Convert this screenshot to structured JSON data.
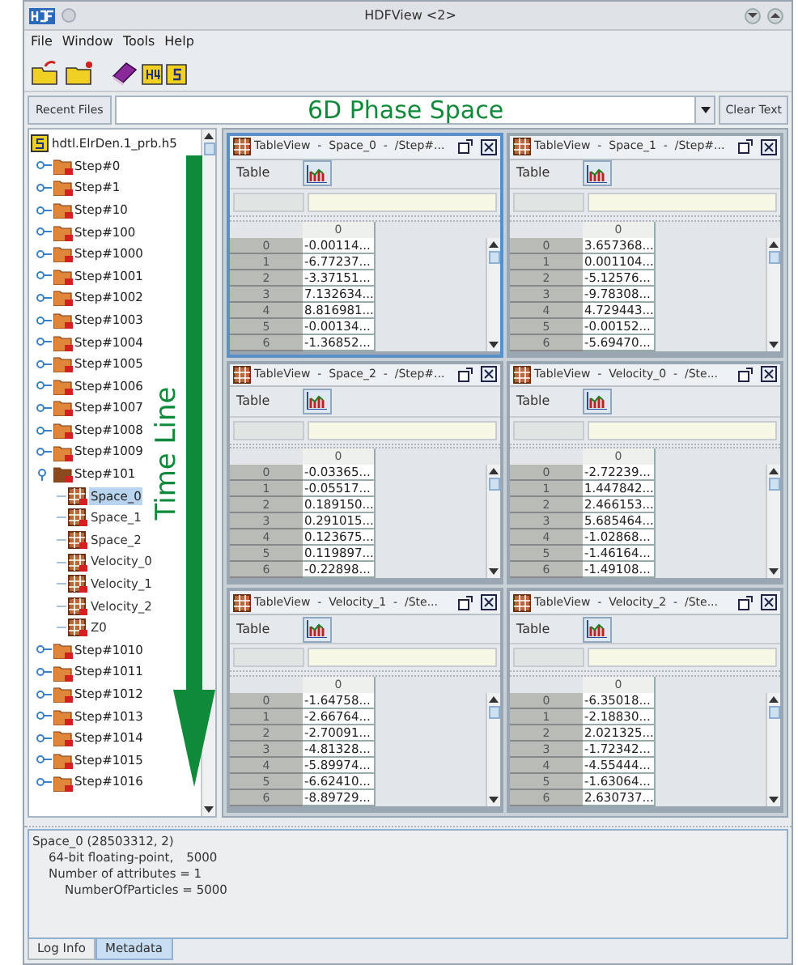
{
  "window": {
    "title": "HDFView <2>"
  },
  "menus": [
    "File",
    "Window",
    "Tools",
    "Help"
  ],
  "recent": {
    "button": "Recent Files",
    "value": "6D Phase Space",
    "clear": "Clear Text"
  },
  "tree": {
    "root": "hdtl.ElrDen.1_prb.h5",
    "annotation": "Time Line",
    "items": [
      {
        "label": "Step#0",
        "expanded": false
      },
      {
        "label": "Step#1",
        "expanded": false
      },
      {
        "label": "Step#10",
        "expanded": false
      },
      {
        "label": "Step#100",
        "expanded": false
      },
      {
        "label": "Step#1000",
        "expanded": false
      },
      {
        "label": "Step#1001",
        "expanded": false
      },
      {
        "label": "Step#1002",
        "expanded": false
      },
      {
        "label": "Step#1003",
        "expanded": false
      },
      {
        "label": "Step#1004",
        "expanded": false
      },
      {
        "label": "Step#1005",
        "expanded": false
      },
      {
        "label": "Step#1006",
        "expanded": false
      },
      {
        "label": "Step#1007",
        "expanded": false
      },
      {
        "label": "Step#1008",
        "expanded": false
      },
      {
        "label": "Step#1009",
        "expanded": false
      },
      {
        "label": "Step#101",
        "expanded": true,
        "children": [
          {
            "label": "Space_0",
            "selected": true
          },
          {
            "label": "Space_1",
            "selected": false
          },
          {
            "label": "Space_2",
            "selected": false
          },
          {
            "label": "Velocity_0",
            "selected": false
          },
          {
            "label": "Velocity_1",
            "selected": false
          },
          {
            "label": "Velocity_2",
            "selected": false
          },
          {
            "label": "Z0",
            "selected": false
          }
        ]
      },
      {
        "label": "Step#1010",
        "expanded": false
      },
      {
        "label": "Step#1011",
        "expanded": false
      },
      {
        "label": "Step#1012",
        "expanded": false
      },
      {
        "label": "Step#1013",
        "expanded": false
      },
      {
        "label": "Step#1014",
        "expanded": false
      },
      {
        "label": "Step#1015",
        "expanded": false
      },
      {
        "label": "Step#1016",
        "expanded": false
      }
    ]
  },
  "tables": [
    {
      "title": "TableView  -  Space_0  -  /Step#...",
      "active": true,
      "menu": "Table",
      "column": "0",
      "rows": [
        [
          "0",
          "-0.00114..."
        ],
        [
          "1",
          "-6.77237..."
        ],
        [
          "2",
          "-3.37151..."
        ],
        [
          "3",
          "7.132634..."
        ],
        [
          "4",
          "8.816981..."
        ],
        [
          "5",
          "-0.00134..."
        ],
        [
          "6",
          "-1.36852..."
        ]
      ]
    },
    {
      "title": "TableView  -  Space_1  -  /Step#...",
      "active": false,
      "menu": "Table",
      "column": "0",
      "rows": [
        [
          "0",
          "3.657368..."
        ],
        [
          "1",
          "0.001104..."
        ],
        [
          "2",
          "-5.12576..."
        ],
        [
          "3",
          "-9.78308..."
        ],
        [
          "4",
          "4.729443..."
        ],
        [
          "5",
          "-0.00152..."
        ],
        [
          "6",
          "-5.69470..."
        ]
      ]
    },
    {
      "title": "TableView  -  Space_2  -  /Step#...",
      "active": false,
      "menu": "Table",
      "column": "0",
      "rows": [
        [
          "0",
          "-0.03365..."
        ],
        [
          "1",
          "-0.05517..."
        ],
        [
          "2",
          "0.189150..."
        ],
        [
          "3",
          "0.291015..."
        ],
        [
          "4",
          "0.123675..."
        ],
        [
          "5",
          "0.119897..."
        ],
        [
          "6",
          "-0.22898..."
        ]
      ]
    },
    {
      "title": "TableView  -  Velocity_0  -  /Ste...",
      "active": false,
      "menu": "Table",
      "column": "0",
      "rows": [
        [
          "0",
          "-2.72239..."
        ],
        [
          "1",
          "1.447842..."
        ],
        [
          "2",
          "2.466153..."
        ],
        [
          "3",
          "5.685464..."
        ],
        [
          "4",
          "-1.02868..."
        ],
        [
          "5",
          "-1.46164..."
        ],
        [
          "6",
          "-1.49108..."
        ]
      ]
    },
    {
      "title": "TableView  -  Velocity_1  -  /Ste...",
      "active": false,
      "menu": "Table",
      "column": "0",
      "rows": [
        [
          "0",
          "-1.64758..."
        ],
        [
          "1",
          "-2.66764..."
        ],
        [
          "2",
          "-2.70091..."
        ],
        [
          "3",
          "-4.81328..."
        ],
        [
          "4",
          "-5.89974..."
        ],
        [
          "5",
          "-6.62410..."
        ],
        [
          "6",
          "-8.89729..."
        ]
      ]
    },
    {
      "title": "TableView  -  Velocity_2  -  /Ste...",
      "active": false,
      "menu": "Table",
      "column": "0",
      "rows": [
        [
          "0",
          "-6.35018..."
        ],
        [
          "1",
          "-2.18830..."
        ],
        [
          "2",
          "2.021325..."
        ],
        [
          "3",
          "-1.72342..."
        ],
        [
          "4",
          "-4.55444..."
        ],
        [
          "5",
          "-1.63064..."
        ],
        [
          "6",
          "2.630737..."
        ]
      ]
    }
  ],
  "metadata": {
    "title": "Space_0 (28503312, 2)",
    "children": [
      {
        "text": "64-bit floating-point,",
        "value": "5000"
      },
      {
        "text": "Number of attributes = 1",
        "children": [
          {
            "text": "NumberOfParticles = 5000"
          }
        ]
      }
    ]
  },
  "bottom_tabs": [
    {
      "label": "Log Info",
      "selected": false
    },
    {
      "label": "Metadata",
      "selected": true
    }
  ]
}
